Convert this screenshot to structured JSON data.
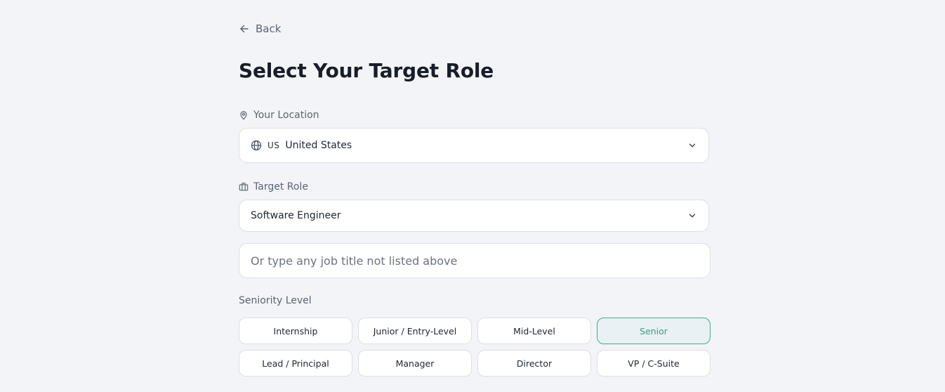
{
  "back": {
    "label": "Back"
  },
  "page_title": "Select Your Target Role",
  "location": {
    "label": "Your Location",
    "country_code": "US",
    "country_name": "United States"
  },
  "target_role": {
    "label": "Target Role",
    "selected": "Software Engineer",
    "custom_placeholder": "Or type any job title not listed above",
    "custom_value": ""
  },
  "seniority": {
    "label": "Seniority Level",
    "selected": "Senior",
    "options": [
      "Internship",
      "Junior / Entry-Level",
      "Mid-Level",
      "Senior",
      "Lead / Principal",
      "Manager",
      "Director",
      "VP / C-Suite"
    ]
  },
  "colors": {
    "background": "#f3f4f7",
    "accent": "#47a98a",
    "active_chip_bg": "#e9f1f5"
  },
  "icons": {
    "back": "arrow-left-icon",
    "location": "map-pin-icon",
    "globe": "globe-icon",
    "role": "briefcase-icon",
    "dropdown": "chevron-down-icon"
  }
}
